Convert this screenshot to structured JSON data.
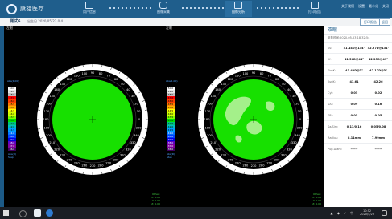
{
  "app": {
    "logo_text": "康捷医疗",
    "nav": [
      {
        "label": "用户信息",
        "icon": "user-info-icon"
      },
      {
        "label": "图像采集",
        "icon": "camera-icon"
      },
      {
        "label": "图像分析",
        "icon": "analysis-icon",
        "active": true
      },
      {
        "label": "打印报告",
        "icon": "print-icon"
      }
    ],
    "top_right": [
      "关于我们",
      "设置",
      "最小化",
      "关闭"
    ]
  },
  "subbar": {
    "patient_name": "测试6",
    "patient_date": "出生日 2020/05/23 0:4",
    "btn_compare": "打印报告",
    "btn_back": "返回"
  },
  "maps": [
    {
      "title": "左眼",
      "legend_title": "Abs(1.00)",
      "legend_units": "D",
      "legend_values": [
        "50.0",
        "49.0",
        "48.0",
        "47.0",
        "46.0",
        "45.5",
        "45.0",
        "44.5",
        "44.0",
        "43.5",
        "43.0",
        "42.5",
        "42.0",
        "41.5",
        "41.0",
        "40.0",
        "39.0",
        "38.0",
        "37.0",
        "36.0"
      ],
      "legend_footer": [
        "Abs(D)",
        "Step"
      ],
      "corner_info": [
        "Offset:",
        "X: 0.00",
        "Y: 0.00",
        "Z: 0.00"
      ]
    },
    {
      "title": "左眼",
      "legend_title": "Abs(1.00)",
      "legend_units": "D",
      "legend_values": [
        "50.0",
        "49.0",
        "48.0",
        "47.0",
        "46.0",
        "45.5",
        "45.0",
        "44.5",
        "44.0",
        "43.5",
        "43.0",
        "42.5",
        "42.0",
        "41.5",
        "41.0",
        "40.0",
        "39.0",
        "38.0",
        "37.0",
        "36.0"
      ],
      "legend_footer": [
        "Abs(D)",
        "Step"
      ],
      "corner_info": [
        "Offset:",
        "X: 0.01",
        "Y: 0.00",
        "Z: 0.00"
      ]
    }
  ],
  "dial_labels": [
    "0",
    "10",
    "20",
    "30",
    "40",
    "50",
    "60",
    "70",
    "80",
    "90",
    "100",
    "110",
    "120",
    "130",
    "140",
    "150",
    "160",
    "170",
    "180",
    "190",
    "200",
    "210",
    "220",
    "230",
    "240",
    "250",
    "260",
    "270",
    "280",
    "290",
    "300",
    "310",
    "320",
    "330",
    "340",
    "350"
  ],
  "side": {
    "title": "双眼",
    "date": "采集时间:2020-05-23 18:32:54",
    "rows": [
      {
        "label": "Ks:",
        "v1": "41.44D@134°",
        "v2": "42.27D@131°"
      },
      {
        "label": "Kf:",
        "v1": "41.56D@44°",
        "v2": "42.25D@41°"
      },
      {
        "label": "SimK:",
        "v1": "41.40D@3°",
        "v2": "42.12D@3°"
      },
      {
        "label": "AvgK:",
        "v1": "41.61",
        "v2": "42.26"
      },
      {
        "label": "Cyl:",
        "v1": "0.05",
        "v2": "0.02"
      },
      {
        "label": "SAI:",
        "v1": "0.09",
        "v2": "0.16"
      },
      {
        "label": "SRI:",
        "v1": "0.05",
        "v2": "0.05"
      },
      {
        "label": "Sa/Sim:",
        "v1": "0.11/0.16",
        "v2": "0.05/0.08"
      },
      {
        "label": "Radius:",
        "v1": "8.11mm",
        "v2": "7.99mm"
      },
      {
        "label": "Pup.Diam:",
        "v1": "------",
        "v2": "------"
      }
    ]
  },
  "taskbar": {
    "time": "10:52",
    "date": "2020/5/23"
  },
  "colors": {
    "green_map": "#17e000",
    "light_green": "#a4f08a",
    "accent": "#1f5e8c"
  }
}
